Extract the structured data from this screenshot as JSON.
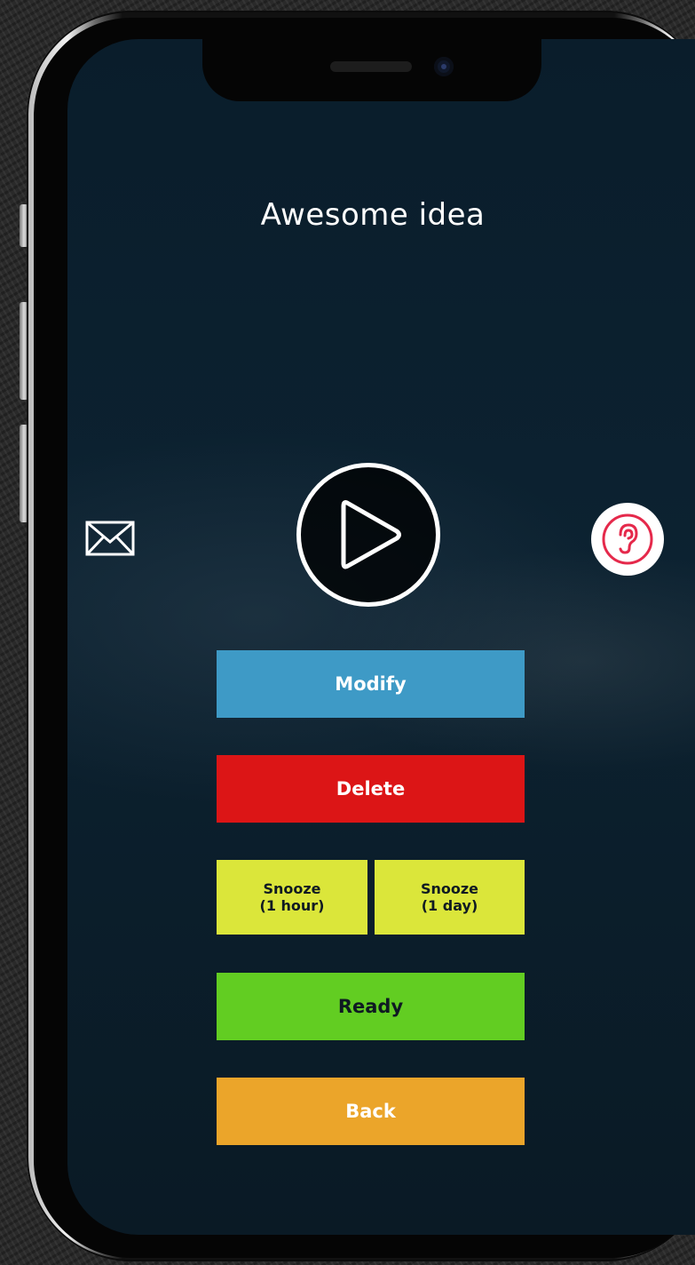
{
  "screen": {
    "title": "Awesome idea"
  },
  "icons": {
    "play": "play-icon",
    "mail": "mail-icon",
    "ear": "ear-icon"
  },
  "actions": {
    "modify": "Modify",
    "delete": "Delete",
    "snooze_hour_line1": "Snooze",
    "snooze_hour_line2": "(1 hour)",
    "snooze_day_line1": "Snooze",
    "snooze_day_line2": "(1 day)",
    "ready": "Ready",
    "back": "Back"
  },
  "colors": {
    "modify": "#3e9ac6",
    "delete": "#dc1516",
    "snooze": "#dbe63a",
    "ready": "#62cd22",
    "back": "#eba52a",
    "ear_accent": "#e5294b",
    "screen_bg": "#0b1e2b"
  }
}
